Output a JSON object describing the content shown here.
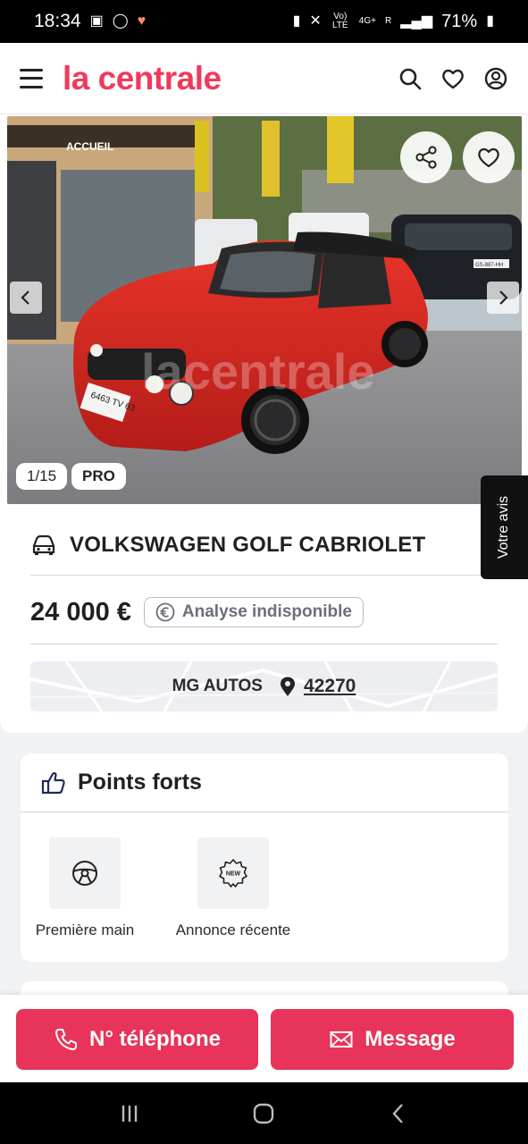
{
  "status_bar": {
    "time": "18:34",
    "network": "4G+",
    "signal_r": "R",
    "volte": "Vo) LTE",
    "battery": "71%"
  },
  "header": {
    "logo": "la centrale",
    "icons": [
      "menu-icon",
      "search-icon",
      "heart-icon",
      "account-icon"
    ]
  },
  "gallery": {
    "counter": "1/15",
    "badge": "PRO",
    "watermark": "lacentrale",
    "sign_accueil": "ACCUEIL",
    "plate_left": "6463 TV 63",
    "plate_right": "GS-887-HH"
  },
  "feedback_tab": {
    "label": "Votre avis"
  },
  "listing": {
    "title": "VOLKSWAGEN GOLF CABRIOLET",
    "price": "24 000 €",
    "analysis": "Analyse indisponible",
    "dealer": "MG AUTOS",
    "zip": "42270"
  },
  "points_forts": {
    "title": "Points forts",
    "items": [
      {
        "label": "Première main",
        "icon": "steering-wheel-icon"
      },
      {
        "label": "Annonce récente",
        "icon": "new-badge-icon",
        "icon_text": "NEW"
      }
    ]
  },
  "actions": {
    "phone": "N° téléphone",
    "message": "Message"
  },
  "colors": {
    "brand": "#ef3a5d",
    "cta": "#e8345a"
  }
}
